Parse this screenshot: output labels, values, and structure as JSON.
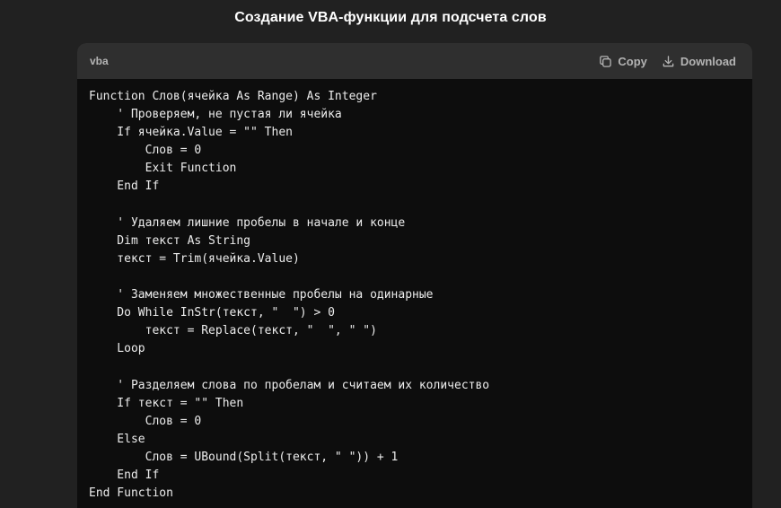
{
  "page": {
    "title": "Создание VBA-функции для подсчета слов"
  },
  "code_block": {
    "language": "vba",
    "copy_label": "Copy",
    "download_label": "Download",
    "lines": [
      "Function Слов(ячейка As Range) As Integer",
      "    ' Проверяем, не пустая ли ячейка",
      "    If ячейка.Value = \"\" Then",
      "        Слов = 0",
      "        Exit Function",
      "    End If",
      "",
      "    ' Удаляем лишние пробелы в начале и конце",
      "    Dim текст As String",
      "    текст = Trim(ячейка.Value)",
      "",
      "    ' Заменяем множественные пробелы на одинарные",
      "    Do While InStr(текст, \"  \") > 0",
      "        текст = Replace(текст, \"  \", \" \")",
      "    Loop",
      "",
      "    ' Разделяем слова по пробелам и считаем их количество",
      "    If текст = \"\" Then",
      "        Слов = 0",
      "    Else",
      "        Слов = UBound(Split(текст, \" \")) + 1",
      "    End If",
      "End Function"
    ]
  },
  "icons": {
    "copy": "copy-icon",
    "download": "download-icon"
  },
  "colors": {
    "page_background": "#212121",
    "header_background": "#2f2f2f",
    "code_background": "#0d0d0d",
    "text": "#ececec",
    "muted_text": "#b4b4b4"
  }
}
